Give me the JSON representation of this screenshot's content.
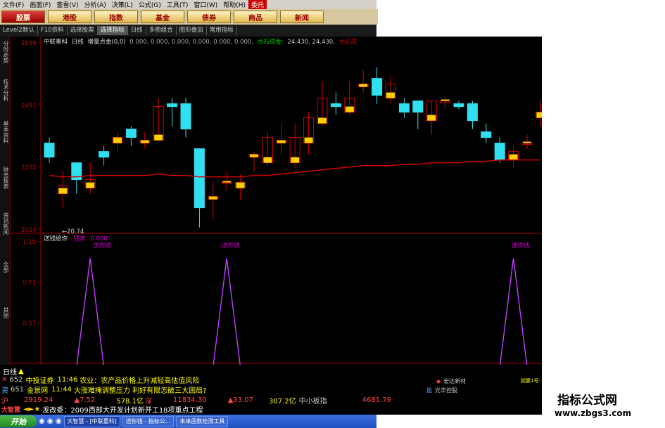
{
  "menu": [
    "文件(F)",
    "画面(F)",
    "查看(V)",
    "分析(A)",
    "决策(L)",
    "公式(G)",
    "工具(T)",
    "窗口(W)",
    "帮助(H)",
    "委托"
  ],
  "market_tabs": [
    "股票",
    "港股",
    "指数",
    "基金",
    "债券",
    "商品",
    "新闻"
  ],
  "toolbar": {
    "level": "Level2默认",
    "f10": "F10资料",
    "select_stock": "选择股票",
    "select_index": "选择指标",
    "period": "日线",
    "multi": "多图组合",
    "overlay": "图形叠加",
    "common": "常用指标"
  },
  "left_tabs": [
    "分时走势",
    "技术分析",
    "基本资料",
    "财务报表",
    "资讯新闻"
  ],
  "left_tabs2": [
    "全部",
    "其他"
  ],
  "stock_header": {
    "name": "中联重科",
    "period": "日线",
    "indicator": "增量点金(0,0)",
    "values": "0.000, 0.000, 0.000, 0.000, 0.000, 0.000,",
    "gold": "点石成金:",
    "gold_values": "24.430, 24.430,",
    "gold_more": "点石成"
  },
  "price_axis": [
    "2699",
    "2491",
    "2282",
    "2024"
  ],
  "low_label": "←20.74",
  "indicator": {
    "name": "送钱给你",
    "sub": "钱来",
    "value": "0.000",
    "peak_label": "送你钱",
    "y_labels": [
      "1.10",
      "0.73",
      "0.37"
    ]
  },
  "bottom_date_left": "20090909",
  "bottom_date_mid": "09",
  "bottom_date_right": "10",
  "period_label": "日线",
  "ticker": {
    "r1_code": "652",
    "r1_name": "中投证券",
    "r1_time": "11:46",
    "r1_text": "农业：农产品价格上升减轻高估值风险",
    "r2_code": "651",
    "r2_name": "金景网",
    "r2_time": "11:44",
    "r2_text": "大涨难掩调整压力 利好有限怎破三大困局?",
    "r3_sh": "沪",
    "r3_v1": "2919.24",
    "r3_c1": "▲7.52",
    "r3_amt1": "578.1亿",
    "r3_sz": "深",
    "r3_v2": "11834.30",
    "r3_c2": "▲33.07",
    "r3_amt2": "307.2亿",
    "r3_small": "中小板指",
    "r3_v3": "4681.79",
    "r4_brand": "大智慧",
    "r4_text": "发改委：2009西部大开发计划新开工18项重点工程",
    "side1": "宏达新材",
    "side2": "光华控股",
    "side3": "超赢1号: 短线资金",
    "side3_time": "11:10:49",
    "side3_time2": "11:02",
    "side3_pct": "+0.00%",
    "side_prefix": "监"
  },
  "taskbar": {
    "start": "开始",
    "t1": "大智慧 - [中联重科]",
    "t2": "送你钱 - 指标公...",
    "t3": "未来函数检测工具"
  },
  "watermark": {
    "cn": "指标公式网",
    "url": "www.zbgs3.com"
  },
  "chart_data": {
    "type": "candlestick",
    "ylim": [
      20.24,
      26.99
    ],
    "candles": [
      {
        "o": 23.4,
        "c": 22.9,
        "h": 23.6,
        "l": 22.7
      },
      {
        "o": 21.6,
        "c": 21.9,
        "h": 22.4,
        "l": 21.1
      },
      {
        "o": 22.7,
        "c": 22.1,
        "h": 22.7,
        "l": 21.6
      },
      {
        "o": 21.8,
        "c": 22.1,
        "h": 22.7,
        "l": 21.6
      },
      {
        "o": 23.1,
        "c": 22.9,
        "h": 23.3,
        "l": 22.6
      },
      {
        "o": 23.4,
        "c": 23.6,
        "h": 23.8,
        "l": 23.1
      },
      {
        "o": 23.9,
        "c": 23.6,
        "h": 24.0,
        "l": 23.3
      },
      {
        "o": 23.4,
        "c": 23.5,
        "h": 23.8,
        "l": 23.2
      },
      {
        "o": 23.5,
        "c": 24.7,
        "h": 25.0,
        "l": 23.5
      },
      {
        "o": 24.8,
        "c": 24.7,
        "h": 25.0,
        "l": 24.0
      },
      {
        "o": 24.8,
        "c": 23.9,
        "h": 25.0,
        "l": 23.6
      },
      {
        "o": 23.2,
        "c": 21.1,
        "h": 23.2,
        "l": 20.4
      },
      {
        "o": 21.4,
        "c": 21.5,
        "h": 22.0,
        "l": 20.7
      },
      {
        "o": 22.0,
        "c": 22.0,
        "h": 22.4,
        "l": 21.7
      },
      {
        "o": 21.8,
        "c": 22.0,
        "h": 22.3,
        "l": 21.4
      },
      {
        "o": 22.9,
        "c": 23.0,
        "h": 23.1,
        "l": 22.4
      },
      {
        "o": 22.7,
        "c": 23.6,
        "h": 23.8,
        "l": 22.6
      },
      {
        "o": 23.4,
        "c": 23.5,
        "h": 24.1,
        "l": 23.0
      },
      {
        "o": 22.7,
        "c": 23.6,
        "h": 24.1,
        "l": 22.5
      },
      {
        "o": 23.4,
        "c": 24.3,
        "h": 24.5,
        "l": 23.0
      },
      {
        "o": 24.1,
        "c": 25.0,
        "h": 25.6,
        "l": 24.0
      },
      {
        "o": 24.8,
        "c": 24.7,
        "h": 25.2,
        "l": 24.4
      },
      {
        "o": 24.5,
        "c": 25.0,
        "h": 25.6,
        "l": 24.4
      },
      {
        "o": 25.4,
        "c": 25.5,
        "h": 26.0,
        "l": 25.2
      },
      {
        "o": 25.7,
        "c": 25.1,
        "h": 26.1,
        "l": 24.8
      },
      {
        "o": 25.0,
        "c": 25.5,
        "h": 25.8,
        "l": 24.8
      },
      {
        "o": 24.8,
        "c": 24.5,
        "h": 25.0,
        "l": 24.3
      },
      {
        "o": 24.9,
        "c": 24.5,
        "h": 24.9,
        "l": 23.9
      },
      {
        "o": 24.2,
        "c": 24.9,
        "h": 24.9,
        "l": 23.7
      },
      {
        "o": 24.9,
        "c": 24.9,
        "h": 25.1,
        "l": 24.6
      },
      {
        "o": 24.8,
        "c": 24.7,
        "h": 24.9,
        "l": 24.6
      },
      {
        "o": 24.8,
        "c": 24.2,
        "h": 24.9,
        "l": 23.9
      },
      {
        "o": 23.8,
        "c": 23.6,
        "h": 24.1,
        "l": 23.4
      },
      {
        "o": 23.4,
        "c": 22.8,
        "h": 23.6,
        "l": 22.7
      },
      {
        "o": 22.8,
        "c": 23.1,
        "h": 23.3,
        "l": 22.5
      },
      {
        "o": 23.4,
        "c": 23.4,
        "h": 23.7,
        "l": 23.2
      },
      {
        "o": 24.3,
        "c": 24.5,
        "h": 24.9,
        "l": 24.0
      }
    ],
    "ma": [
      22.25,
      22.2,
      22.2,
      22.25,
      22.25,
      22.25,
      22.25,
      22.25,
      22.3,
      22.25,
      22.25,
      22.2,
      22.2,
      22.2,
      22.2,
      22.25,
      22.25,
      22.3,
      22.35,
      22.4,
      22.45,
      22.5,
      22.55,
      22.6,
      22.6,
      22.6,
      22.65,
      22.65,
      22.7,
      22.7,
      22.7,
      22.75,
      22.75,
      22.8,
      22.8,
      22.8,
      22.8
    ],
    "indicator_series": {
      "ylim": [
        0,
        1.1
      ],
      "values": [
        0,
        0,
        0,
        1.0,
        0,
        0,
        0,
        0,
        0,
        0,
        0,
        0,
        0,
        1.0,
        0,
        0,
        0,
        0,
        0,
        0,
        0,
        0,
        0,
        0,
        0,
        0,
        0,
        0,
        0,
        0,
        0,
        0,
        0,
        0,
        1.0,
        0,
        0
      ]
    }
  }
}
